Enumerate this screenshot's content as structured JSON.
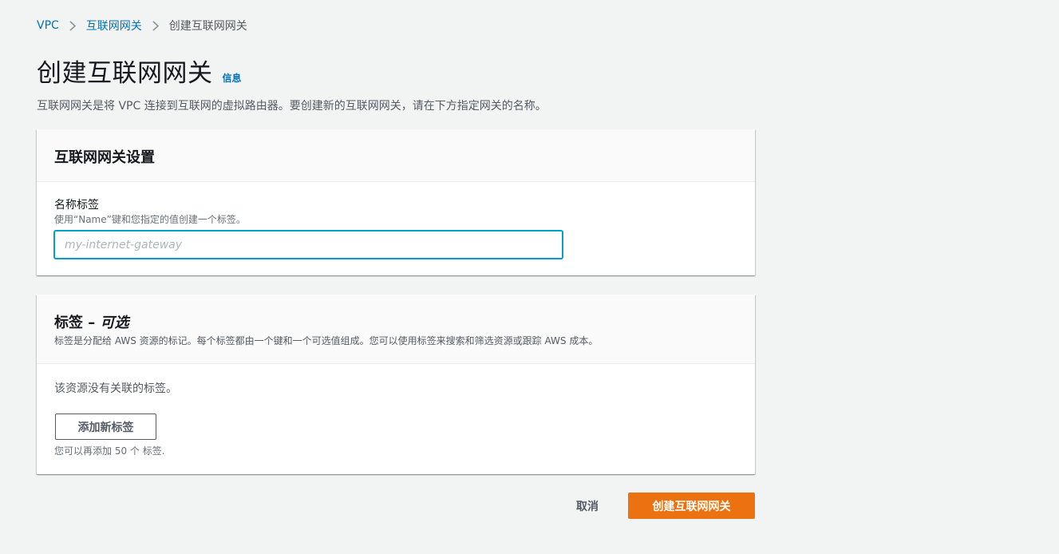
{
  "breadcrumb": {
    "items": [
      {
        "label": "VPC"
      },
      {
        "label": "互联网网关"
      },
      {
        "label": "创建互联网网关"
      }
    ],
    "separator_icon": "chevron-right-icon"
  },
  "header": {
    "title": "创建互联网网关",
    "info_link": "信息",
    "description": "互联网网关是将 VPC 连接到互联网的虚拟路由器。要创建新的互联网网关，请在下方指定网关的名称。"
  },
  "settings_panel": {
    "title": "互联网网关设置",
    "name_field": {
      "label": "名称标签",
      "description": "使用“Name”键和您指定的值创建一个标签。",
      "value": "",
      "placeholder": "my-internet-gateway"
    }
  },
  "tags_panel": {
    "title": "标签 – ",
    "title_optional": "可选",
    "description": "标签是分配给 AWS 资源的标记。每个标签都由一个键和一个可选值组成。您可以使用标签来搜索和筛选资源或跟踪 AWS 成本。",
    "empty_text": "该资源没有关联的标签。",
    "add_button": "添加新标签",
    "limit_text": "您可以再添加 50 个 标签."
  },
  "footer": {
    "cancel_button": "取消",
    "create_button": "创建互联网网关"
  },
  "colors": {
    "link": "#0073bb",
    "primary_button": "#ec7211",
    "input_focus": "#00a1c9",
    "background": "#f2f3f3"
  }
}
